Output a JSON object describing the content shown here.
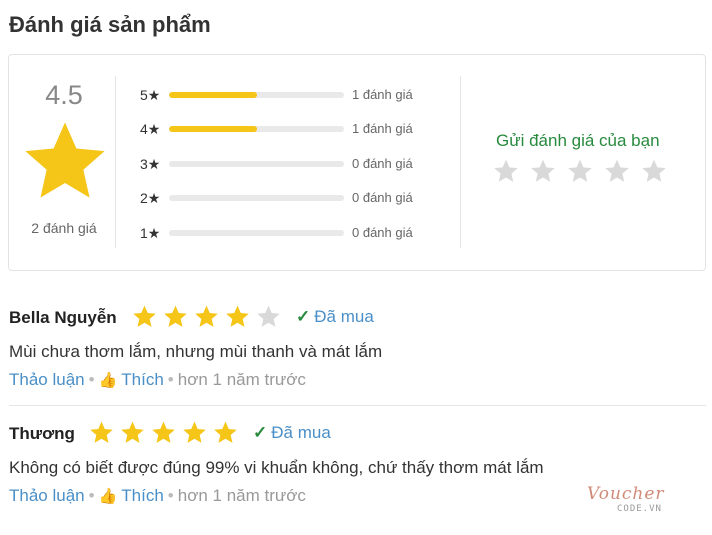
{
  "section_title": "Đánh giá sản phẩm",
  "summary": {
    "average": "4.5",
    "total_label": "2 đánh giá",
    "rows": [
      {
        "level": "5★",
        "count_label": "1 đánh giá",
        "fraction": 0.5
      },
      {
        "level": "4★",
        "count_label": "1 đánh giá",
        "fraction": 0.5
      },
      {
        "level": "3★",
        "count_label": "0 đánh giá",
        "fraction": 0
      },
      {
        "level": "2★",
        "count_label": "0 đánh giá",
        "fraction": 0
      },
      {
        "level": "1★",
        "count_label": "0 đánh giá",
        "fraction": 0
      }
    ]
  },
  "send_review": {
    "title": "Gửi đánh giá của bạn",
    "stars": 5
  },
  "reviews": [
    {
      "name": "Bella Nguyễn",
      "rating": 4,
      "bought_label": "Đã mua",
      "text": "Mùi chưa thơm lắm, nhưng mùi thanh và mát lắm",
      "discuss_label": "Thảo luận",
      "like_label": "Thích",
      "time": "hơn 1 năm trước"
    },
    {
      "name": "Thương",
      "rating": 5,
      "bought_label": "Đã mua",
      "text": "Không có biết được đúng 99% vi khuẩn không, chứ thấy thơm mát lắm",
      "discuss_label": "Thảo luận",
      "like_label": "Thích",
      "time": "hơn 1 năm trước"
    }
  ],
  "watermark": {
    "line1": "Voucher",
    "line2": "CODE.VN"
  },
  "colors": {
    "star_filled": "#f5c518",
    "star_empty": "#d9d9d9",
    "green": "#288a3e",
    "link": "#4a8fc7"
  }
}
